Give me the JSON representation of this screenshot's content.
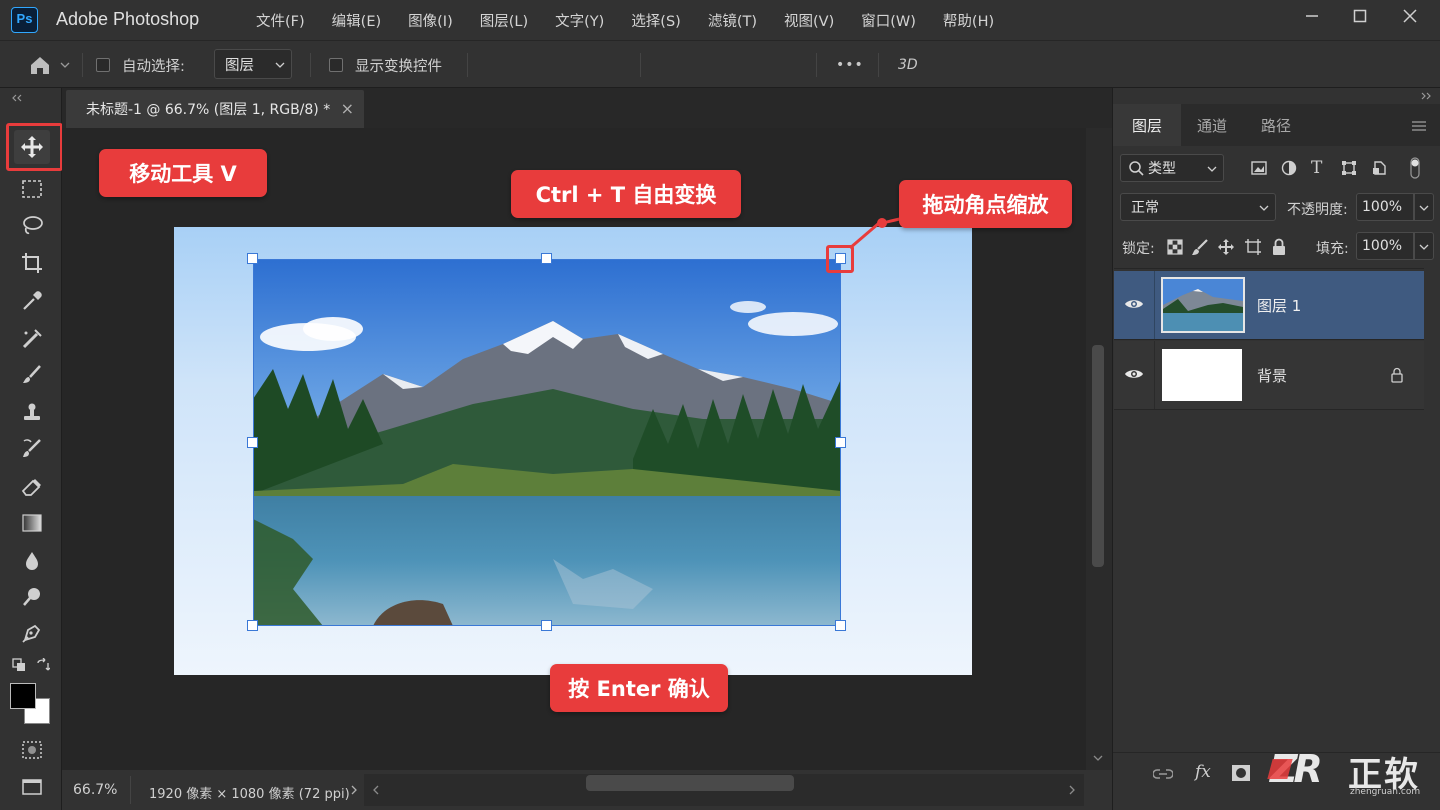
{
  "app": {
    "logo": "Ps",
    "name": "Adobe Photoshop"
  },
  "menu": [
    "文件(F)",
    "编辑(E)",
    "图像(I)",
    "图层(L)",
    "文字(Y)",
    "选择(S)",
    "滤镜(T)",
    "视图(V)",
    "窗口(W)",
    "帮助(H)"
  ],
  "options": {
    "auto_select_label": "自动选择:",
    "auto_select_value": "图层",
    "show_transform_label": "显示变换控件",
    "more": "•••",
    "three_d": "3D"
  },
  "document": {
    "tab_title": "未标题-1 @ 66.7% (图层 1, RGB/8) *",
    "close": "×"
  },
  "status": {
    "zoom": "66.7%",
    "info": "1920 像素 × 1080 像素 (72 ppi)"
  },
  "layers_panel": {
    "tabs": [
      "图层",
      "通道",
      "路径"
    ],
    "filter_kind": "类型",
    "blend_mode": "正常",
    "opacity_label": "不透明度:",
    "opacity_value": "100%",
    "lock_label": "锁定:",
    "fill_label": "填充:",
    "fill_value": "100%",
    "layers": [
      {
        "name": "图层 1",
        "selected": true,
        "visible": true
      },
      {
        "name": "背景",
        "selected": false,
        "visible": true,
        "locked": true
      }
    ]
  },
  "callouts": {
    "move_tool": "移动工具  V",
    "free_transform": "Ctrl + T  自由变换",
    "drag_corner": "拖动角点缩放",
    "confirm": "按 Enter 确认"
  },
  "watermark": {
    "logo": "ZR",
    "name": "正软",
    "url": "zhengruan.com"
  },
  "colors": {
    "accent_red": "#e83c3c",
    "selection_blue": "#3a78d6",
    "panel_bg": "#323232",
    "ps_blue": "#31a8ff"
  }
}
